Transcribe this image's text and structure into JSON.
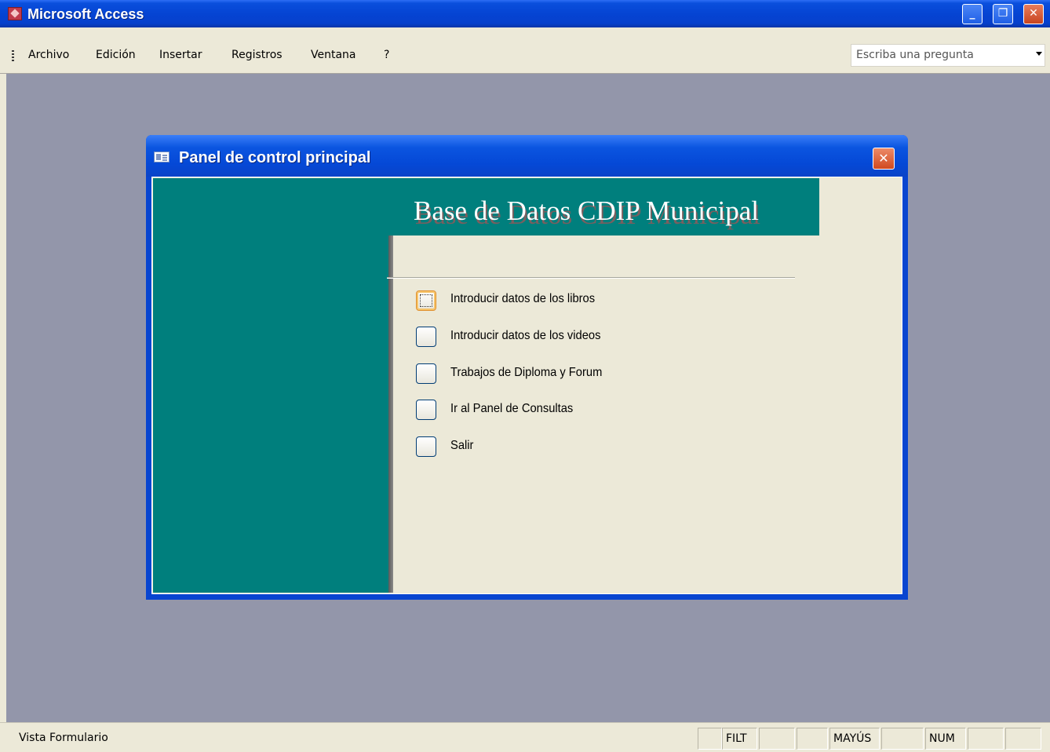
{
  "app": {
    "title": "Microsoft Access",
    "icon": "access-key-icon"
  },
  "window_controls": {
    "minimize": "_",
    "restore": "❐",
    "close": "✕"
  },
  "menu": {
    "items": [
      {
        "label": "Archivo"
      },
      {
        "label": "Edición"
      },
      {
        "label": "Insertar"
      },
      {
        "label": "Registros"
      },
      {
        "label": "Ventana"
      },
      {
        "label": "?"
      }
    ],
    "ask_placeholder": "Escriba una pregunta"
  },
  "dialog": {
    "title": "Panel de control principal",
    "close": "✕",
    "header_title": "Base de Datos CDIP Municipal",
    "options": [
      {
        "label": "Introducir datos de los libros"
      },
      {
        "label": "Introducir datos de los videos"
      },
      {
        "label": "Trabajos de Diploma y Forum"
      },
      {
        "label": "Ir al Panel de Consultas"
      },
      {
        "label": "Salir"
      }
    ]
  },
  "status": {
    "text": "Vista Formulario",
    "panes": [
      "FILT",
      "",
      "",
      "MAYÚS",
      "",
      "NUM",
      "",
      ""
    ]
  },
  "colors": {
    "title_blue": "#0548d6",
    "teal": "#007f7d",
    "workspace": "#9396aa",
    "face": "#ece9d8"
  }
}
